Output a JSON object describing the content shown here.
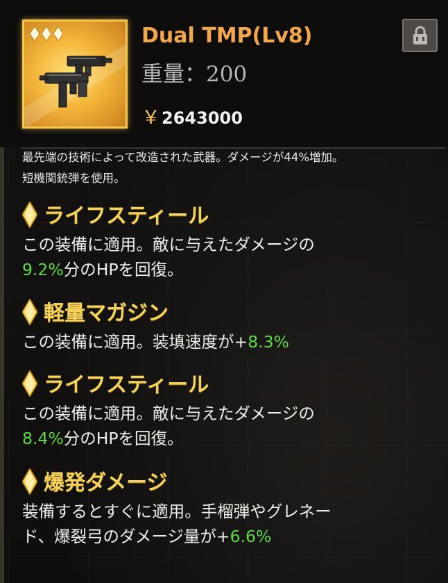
{
  "item": {
    "name": "Dual TMP(Lv8)",
    "weight_label": "重量：200",
    "currency_symbol": "￥",
    "price": "2643000",
    "rarity_stars": 3,
    "icon": "smg-icon",
    "lock_icon": "lock-icon"
  },
  "description": {
    "line1": "最先端の技術によって改造された武器。ダメージが44%増加。",
    "line2": "短機関銃弾を使用。"
  },
  "skills": [
    {
      "name": "ライフスティール",
      "lines": [
        [
          {
            "t": "この装備に適用。敵に与えたダメージの"
          }
        ],
        [
          {
            "t": "9.2%",
            "hl": true
          },
          {
            "t": "分のHPを回復。"
          }
        ]
      ]
    },
    {
      "name": "軽量マガジン",
      "lines": [
        [
          {
            "t": "この装備に適用。装填速度が+"
          },
          {
            "t": "8.3%",
            "hl": true
          }
        ]
      ]
    },
    {
      "name": "ライフスティール",
      "lines": [
        [
          {
            "t": "この装備に適用。敵に与えたダメージの"
          }
        ],
        [
          {
            "t": "8.4%",
            "hl": true
          },
          {
            "t": "分のHPを回復。"
          }
        ]
      ]
    },
    {
      "name": "爆発ダメージ",
      "lines": [
        [
          {
            "t": "装備するとすぐに適用。手榴弾やグレネー"
          }
        ],
        [
          {
            "t": "ド、爆裂弓のダメージ量が+"
          },
          {
            "t": "6.6%",
            "hl": true
          }
        ]
      ]
    }
  ],
  "colors": {
    "title": "#f4a64a",
    "skill_name": "#f6d35a",
    "highlight": "#5ddc43",
    "frame_gold": "#f8c64a"
  }
}
